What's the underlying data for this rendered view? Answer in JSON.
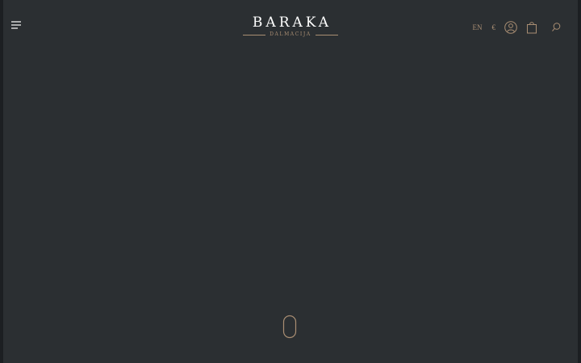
{
  "header": {
    "logo": {
      "title": "BARAKA",
      "subtitle": "DALMACIJA"
    },
    "language": "EN",
    "currency": "€",
    "icons": {
      "menu": "hamburger-menu-icon",
      "account": "user-account-icon",
      "cart": "shopping-bag-icon",
      "search": "search-icon"
    }
  },
  "hero": {
    "scroll_indicator": "mouse-scroll-icon"
  },
  "colors": {
    "background": "#2b2f32",
    "accent": "#a98e73",
    "logo": "#ffffff"
  }
}
